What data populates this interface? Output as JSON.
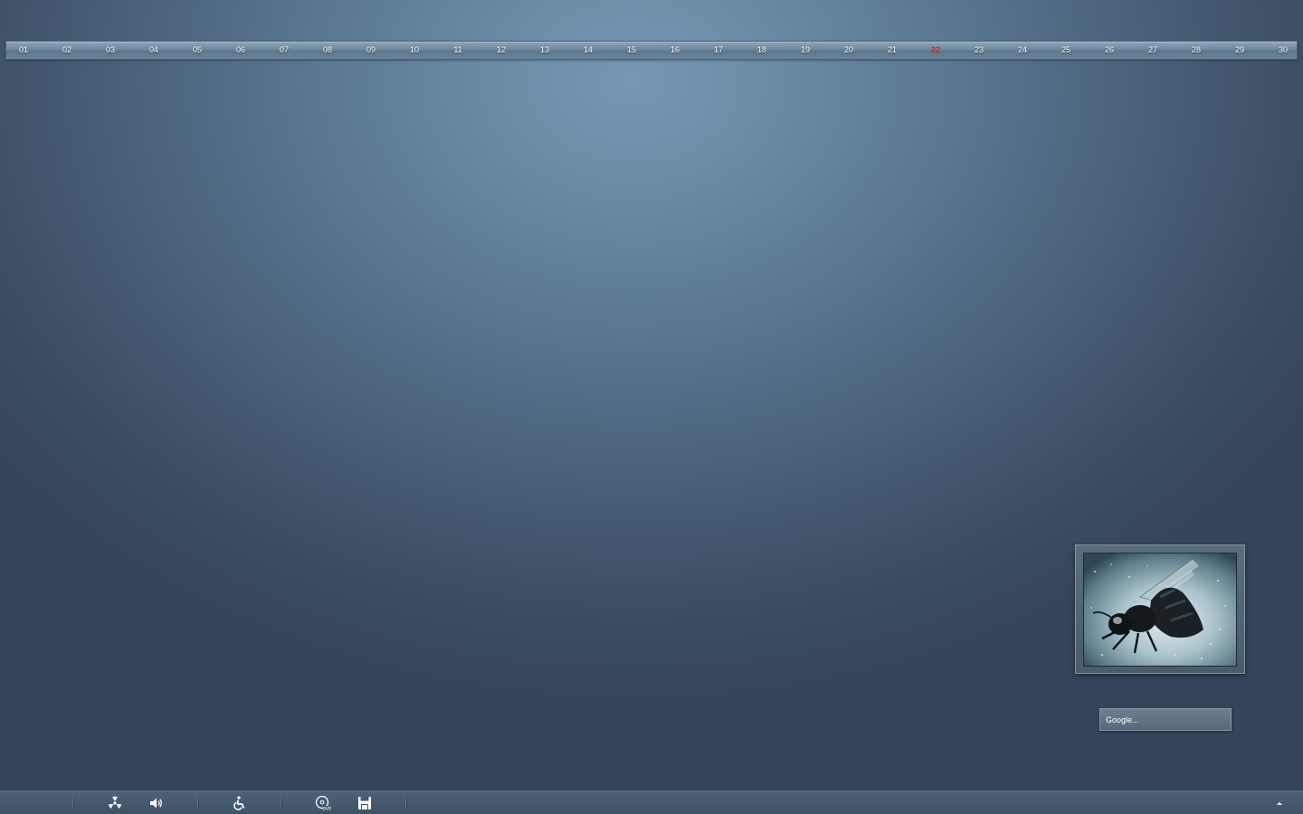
{
  "calendar": {
    "days": [
      "01",
      "02",
      "03",
      "04",
      "05",
      "06",
      "07",
      "08",
      "09",
      "10",
      "11",
      "12",
      "13",
      "14",
      "15",
      "16",
      "17",
      "18",
      "19",
      "20",
      "21",
      "22",
      "23",
      "24",
      "25",
      "26",
      "27",
      "28",
      "29",
      "30"
    ],
    "today": "22",
    "today_color": "#d21c1c"
  },
  "photo_widget": {
    "icon": "wasp-photo"
  },
  "google_search": {
    "placeholder": "Google..."
  },
  "taskbar": {
    "icons": [
      "radiation-icon",
      "speaker-icon",
      "wheelchair-icon",
      "dvd-disc-icon",
      "floppy-disk-icon"
    ],
    "tray_expand_icon": "chevron-up-icon"
  },
  "colors": {
    "background": "#5a7690",
    "taskbar": "#465a6f",
    "calendar_bar": "#6e889e"
  }
}
